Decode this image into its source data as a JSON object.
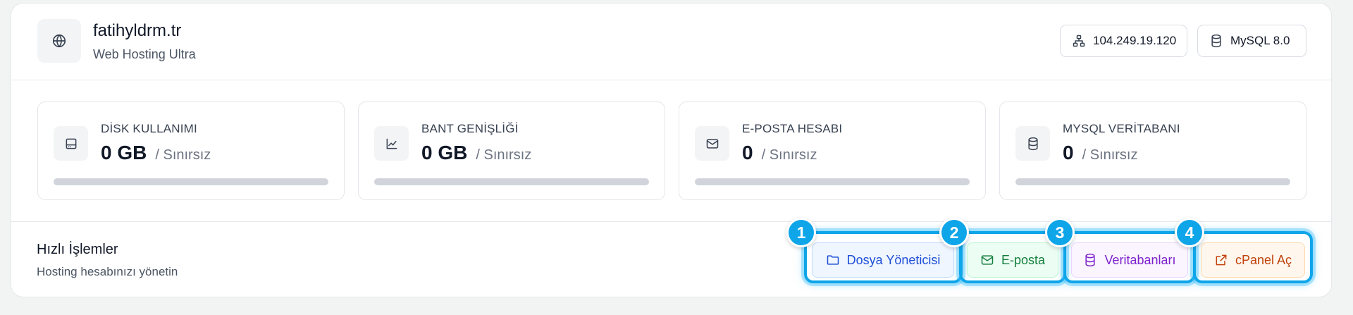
{
  "site": {
    "name": "fatihyldrm.tr",
    "plan": "Web Hosting Ultra",
    "icon": "globe-icon"
  },
  "chips": {
    "ip": {
      "label": "104.249.19.120",
      "icon": "network-icon"
    },
    "db": {
      "label": "MySQL 8.0",
      "icon": "database-icon"
    }
  },
  "stats": [
    {
      "label": "DİSK KULLANIMI",
      "value": "0 GB",
      "limit": "/ Sınırsız",
      "icon": "hard-drive-icon",
      "usage_fraction": 0
    },
    {
      "label": "BANT GENİŞLİĞİ",
      "value": "0 GB",
      "limit": "/ Sınırsız",
      "icon": "line-chart-icon",
      "usage_fraction": 0
    },
    {
      "label": "E-POSTA HESABI",
      "value": "0",
      "limit": "/ Sınırsız",
      "icon": "mail-icon",
      "usage_fraction": 0
    },
    {
      "label": "MYSQL VERİTABANI",
      "value": "0",
      "limit": "/ Sınırsız",
      "icon": "database-icon",
      "usage_fraction": 0
    }
  ],
  "quick_actions": {
    "title": "Hızlı İşlemler",
    "subtitle": "Hosting hesabınızı yönetin",
    "buttons": [
      {
        "badge": "1",
        "label": "Dosya Yöneticisi",
        "icon": "folder-icon"
      },
      {
        "badge": "2",
        "label": "E-posta",
        "icon": "mail-icon"
      },
      {
        "badge": "3",
        "label": "Veritabanları",
        "icon": "database-icon"
      },
      {
        "badge": "4",
        "label": "cPanel Aç",
        "icon": "external-link-icon"
      }
    ]
  },
  "colors": {
    "highlight": "#0ea5e9",
    "file_manager": "#1d4ed8",
    "email": "#15803d",
    "databases": "#7e22ce",
    "cpanel": "#c2410c"
  }
}
